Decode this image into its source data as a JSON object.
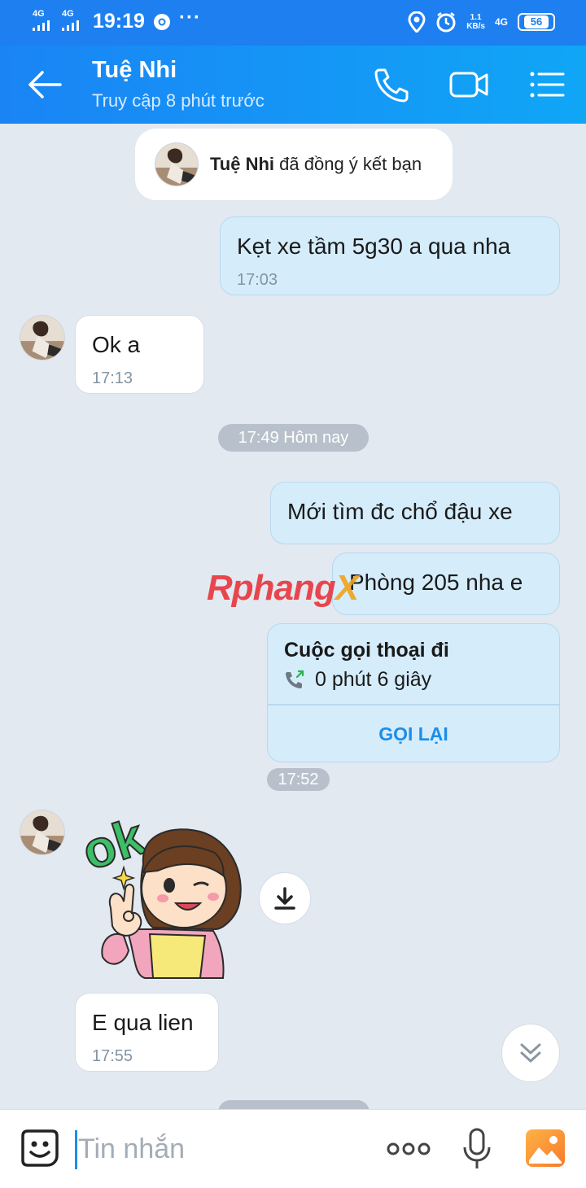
{
  "status_bar": {
    "signal_1": "4G",
    "signal_2": "4G",
    "time": "19:19",
    "more": "···",
    "net_speed_value": "1.1",
    "net_speed_unit": "KB/s",
    "network": "4G",
    "battery": "56"
  },
  "header": {
    "contact_name": "Tuệ Nhi",
    "last_seen": "Truy cập 8 phút trước"
  },
  "system_message": {
    "name": "Tuệ Nhi",
    "text": "đã đồng ý kết bạn"
  },
  "messages": {
    "m1": {
      "text": "Kẹt xe tầm 5g30 a qua nha",
      "time": "17:03"
    },
    "m2": {
      "text": "Ok a",
      "time": "17:13"
    },
    "divider_1": "17:49 Hôm nay",
    "m3": {
      "text": "Mới tìm đc chổ đậu xe"
    },
    "m4": {
      "text": "Phòng 205 nha e"
    },
    "call": {
      "title": "Cuộc gọi thoại đi",
      "duration": "0 phút 6 giây",
      "action": "GỌI LẠI"
    },
    "divider_2": "17:52",
    "sticker_label": "ok",
    "m5": {
      "text": "E qua lien",
      "time": "17:55"
    }
  },
  "watermark": {
    "part1": "Rphang",
    "part2": "X"
  },
  "input_bar": {
    "placeholder": "Tin nhắn"
  },
  "colors": {
    "header_blue": "#1a84f5",
    "outgoing_bubble": "#d5ecfb",
    "background": "#e2e9f1",
    "accent": "#1b8ee8"
  }
}
